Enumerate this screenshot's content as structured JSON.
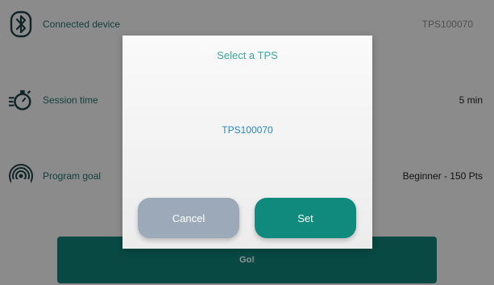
{
  "settings": {
    "rows": [
      {
        "label": "Connected device",
        "value": "TPS100070",
        "icon": "bluetooth-icon"
      },
      {
        "label": "Session time",
        "value": "5 min",
        "icon": "stopwatch-icon"
      },
      {
        "label": "Program goal",
        "value": "Beginner - 150 Pts",
        "icon": "signal-waves-icon"
      }
    ]
  },
  "go_button": {
    "label": "Go!"
  },
  "dialog": {
    "title": "Select a TPS",
    "option": "TPS100070",
    "cancel_label": "Cancel",
    "set_label": "Set"
  },
  "colors": {
    "accent": "#0f8a7d",
    "title": "#3aa89c",
    "link": "#2a86c8",
    "cancel": "#9ba9b8"
  }
}
